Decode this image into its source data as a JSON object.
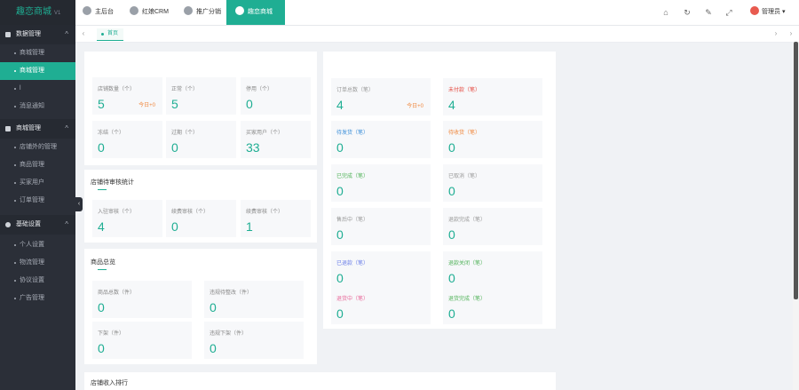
{
  "brand": {
    "name": "趣恋商城",
    "version": "V1"
  },
  "sidebar": {
    "groups": [
      {
        "label": "数据管理",
        "items": [
          {
            "label": "商城管理",
            "active": false
          },
          {
            "label": "商城管理",
            "active": true
          },
          {
            "label": "l",
            "active": false
          },
          {
            "label": "消息通知",
            "active": false
          }
        ]
      },
      {
        "label": "商城管理",
        "items": [
          {
            "label": "店铺外的管理"
          },
          {
            "label": "商品管理"
          },
          {
            "label": "买家用户"
          },
          {
            "label": "订单管理"
          }
        ]
      },
      {
        "label": "基础设置",
        "items": [
          {
            "label": "个人设置"
          },
          {
            "label": "物流管理"
          },
          {
            "label": "协议设置"
          },
          {
            "label": "广告管理"
          }
        ]
      }
    ],
    "collapse_label": "‹"
  },
  "topbar": {
    "modules": [
      {
        "label": "主后台"
      },
      {
        "label": "红娘CRM"
      },
      {
        "label": "推广分销"
      },
      {
        "label": "趣恋商城"
      }
    ],
    "icons": [
      "home-icon",
      "refresh-icon",
      "clear-icon",
      "fullscreen-icon"
    ],
    "user": {
      "name": "管理员",
      "caret": "▾"
    }
  },
  "tabs": {
    "prev": "‹",
    "next": "›",
    "close": "›",
    "items": [
      {
        "label": "首页"
      }
    ]
  },
  "overview": {
    "stats": [
      {
        "label": "店铺数量（个）",
        "value": "5",
        "today": "今日+0"
      },
      {
        "label": "正常（个）",
        "value": "5"
      },
      {
        "label": "停用（个）",
        "value": "0"
      },
      {
        "label": "冻结（个）",
        "value": "0"
      },
      {
        "label": "过期（个）",
        "value": "0"
      },
      {
        "label": "买家用户（个）",
        "value": "33"
      }
    ]
  },
  "pending": {
    "title": "店铺待审核统计",
    "stats": [
      {
        "label": "入驻审核（个）",
        "value": "4"
      },
      {
        "label": "续费审核（个）",
        "value": "0"
      },
      {
        "label": "续费审核（个）",
        "value": "1"
      }
    ]
  },
  "goods": {
    "title": "商品总览",
    "stats": [
      {
        "label": "商品总数（件）",
        "value": "0"
      },
      {
        "label": "违规待整改（件）",
        "value": "0"
      },
      {
        "label": "下架（件）",
        "value": "0"
      },
      {
        "label": "违规下架（件）",
        "value": "0"
      }
    ]
  },
  "orders": {
    "stats": [
      {
        "label": "订单总数（笔）",
        "value": "4",
        "today": "今日+0",
        "color": "#999999"
      },
      {
        "label": "未付款（笔）",
        "value": "4",
        "color": "#e5483e"
      },
      {
        "label": "待发货（笔）",
        "value": "0",
        "color": "#3d8fd9"
      },
      {
        "label": "待收货（笔）",
        "value": "0",
        "color": "#f0883e"
      },
      {
        "label": "已完成（笔）",
        "value": "0",
        "color": "#52b35a"
      },
      {
        "label": "已取消（笔）",
        "value": "0",
        "color": "#999999"
      },
      {
        "label": "售后中（笔）",
        "value": "0",
        "color": "#999999"
      },
      {
        "label": "退款完成（笔）",
        "value": "0",
        "color": "#999999"
      },
      {
        "label": "已退款（笔）",
        "value": "0",
        "color": "#6a7ee8"
      },
      {
        "label": "退款关闭（笔）",
        "value": "0",
        "color": "#52b35a"
      },
      {
        "label": "退货中（笔）",
        "value": "0",
        "color": "#e86a9a"
      },
      {
        "label": "退货完成（笔）",
        "value": "0",
        "color": "#52b35a"
      }
    ]
  },
  "bottom": {
    "title": "店铺收入排行"
  },
  "colors": {
    "accent": "#1fae93",
    "sidebar": "#2b2f38",
    "today": "#f0883e"
  }
}
